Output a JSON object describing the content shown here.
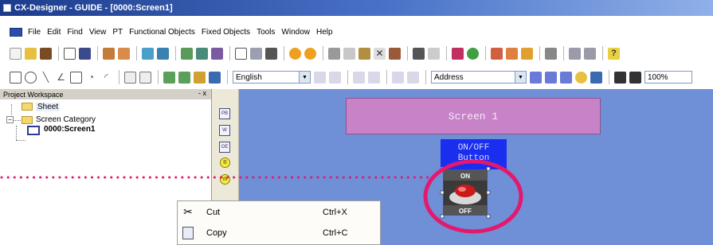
{
  "window": {
    "title": "CX-Designer - GUIDE - [0000:Screen1]"
  },
  "menubar": {
    "items": [
      "File",
      "Edit",
      "Find",
      "View",
      "PT",
      "Functional Objects",
      "Fixed Objects",
      "Tools",
      "Window",
      "Help"
    ]
  },
  "toolbar": {
    "language_value": "English",
    "address_value": "Address",
    "zoom_value": "100%"
  },
  "workspace": {
    "title": "Project Workspace",
    "controls": "- x",
    "tree": {
      "sheet": "Sheet",
      "screen_category": "Screen Category",
      "screen": "0000:Screen1"
    }
  },
  "palette": {
    "items": [
      "PB",
      "W",
      "OE",
      "B",
      "W"
    ]
  },
  "canvas": {
    "screen_label": "Screen 1",
    "button_label_line1": "ON/OFF",
    "button_label_line2": "Button",
    "toggle_on": "ON",
    "toggle_off": "OFF"
  },
  "context_menu": {
    "items": [
      {
        "label": "Cut",
        "shortcut": "Ctrl+X",
        "icon": "scissors-icon"
      },
      {
        "label": "Copy",
        "shortcut": "Ctrl+C",
        "icon": "copy-icon"
      }
    ]
  },
  "colors": {
    "titlebar": "#1c3b8c",
    "canvas": "#6f8fd6",
    "screen_label_fill": "#c882c8",
    "onoff_button_fill": "#1a2ef0",
    "highlight": "#e4186e"
  }
}
